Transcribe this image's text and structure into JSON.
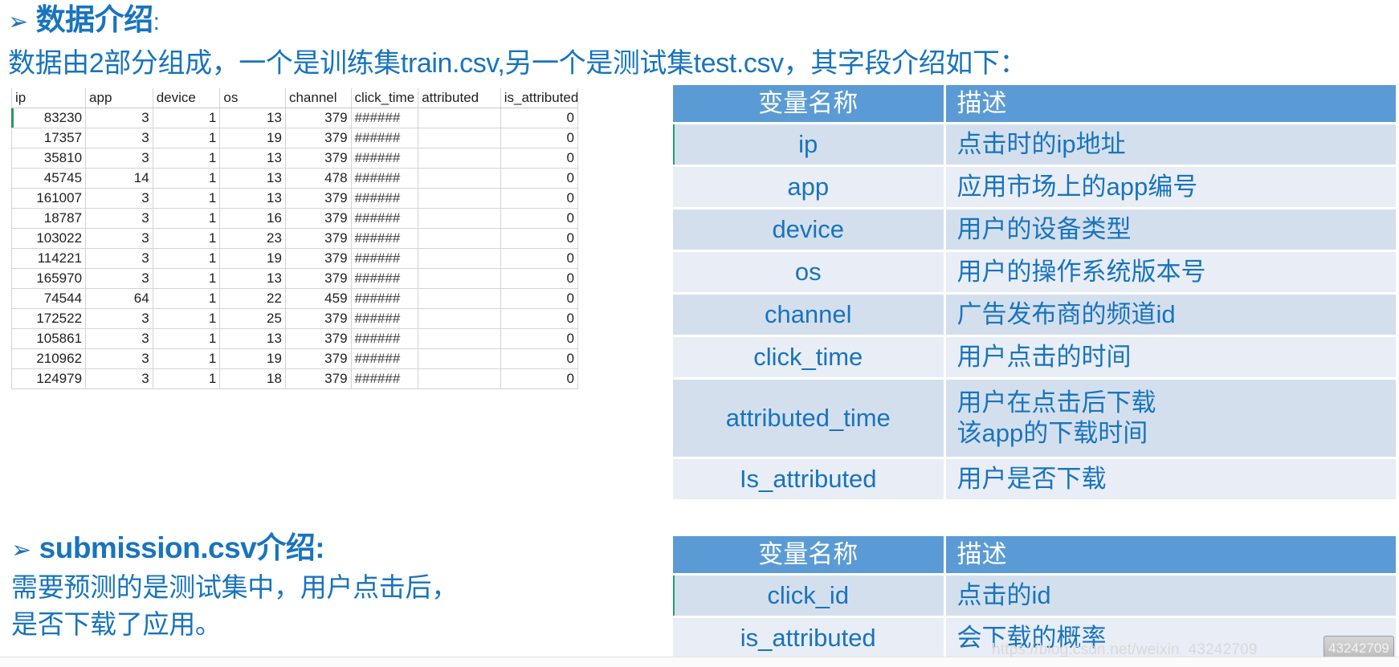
{
  "slide": {
    "heading": {
      "bullet_glyph": "➢",
      "title": "数据介绍",
      "colon": ":",
      "subtitle": "数据由2部分组成，一个是训练集train.csv,另一个是测试集test.csv，其字段介绍如下："
    },
    "spreadsheet": {
      "columns": [
        "ip",
        "app",
        "device",
        "os",
        "channel",
        "click_time",
        "attributed",
        "is_attributed"
      ],
      "rows": [
        [
          "83230",
          "3",
          "1",
          "13",
          "379",
          "######",
          "",
          "0"
        ],
        [
          "17357",
          "3",
          "1",
          "19",
          "379",
          "######",
          "",
          "0"
        ],
        [
          "35810",
          "3",
          "1",
          "13",
          "379",
          "######",
          "",
          "0"
        ],
        [
          "45745",
          "14",
          "1",
          "13",
          "478",
          "######",
          "",
          "0"
        ],
        [
          "161007",
          "3",
          "1",
          "13",
          "379",
          "######",
          "",
          "0"
        ],
        [
          "18787",
          "3",
          "1",
          "16",
          "379",
          "######",
          "",
          "0"
        ],
        [
          "103022",
          "3",
          "1",
          "23",
          "379",
          "######",
          "",
          "0"
        ],
        [
          "114221",
          "3",
          "1",
          "19",
          "379",
          "######",
          "",
          "0"
        ],
        [
          "165970",
          "3",
          "1",
          "13",
          "379",
          "######",
          "",
          "0"
        ],
        [
          "74544",
          "64",
          "1",
          "22",
          "459",
          "######",
          "",
          "0"
        ],
        [
          "172522",
          "3",
          "1",
          "25",
          "379",
          "######",
          "",
          "0"
        ],
        [
          "105861",
          "3",
          "1",
          "13",
          "379",
          "######",
          "",
          "0"
        ],
        [
          "210962",
          "3",
          "1",
          "19",
          "379",
          "######",
          "",
          "0"
        ],
        [
          "124979",
          "3",
          "1",
          "18",
          "379",
          "######",
          "",
          "0"
        ]
      ]
    },
    "submission": {
      "bullet_glyph": "➢",
      "title": "submission.csv介绍:",
      "line1": "需要预测的是测试集中，用户点击后，",
      "line2": "是否下载了应用。"
    },
    "field_table": {
      "header": {
        "name": "变量名称",
        "desc": "描述"
      },
      "rows": [
        {
          "name": "ip",
          "desc": "点击时的ip地址"
        },
        {
          "name": "app",
          "desc": "应用市场上的app编号"
        },
        {
          "name": "device",
          "desc": "用户的设备类型"
        },
        {
          "name": "os",
          "desc": "用户的操作系统版本号"
        },
        {
          "name": "channel",
          "desc": "广告发布商的频道id"
        },
        {
          "name": "click_time",
          "desc": "用户点击的时间"
        },
        {
          "name": "attributed_time",
          "desc": "用户在点击后下载\n该app的下载时间"
        },
        {
          "name": "Is_attributed",
          "desc": "用户是否下载"
        }
      ]
    },
    "submission_table": {
      "header": {
        "name": "变量名称",
        "desc": "描述"
      },
      "rows": [
        {
          "name": "click_id",
          "desc": "点击的id"
        },
        {
          "name": "is_attributed",
          "desc": "会下载的概率"
        }
      ]
    },
    "watermark": {
      "url": "https://blog.csdn.net/weixin_43242709",
      "badge": "43242709"
    },
    "colors": {
      "accent_blue": "#1874bd",
      "table_header_blue": "#5b9bd5",
      "band_dark": "#d4dfee",
      "band_light": "#e9edf5",
      "sheet_grid": "#d4d4d4"
    }
  }
}
